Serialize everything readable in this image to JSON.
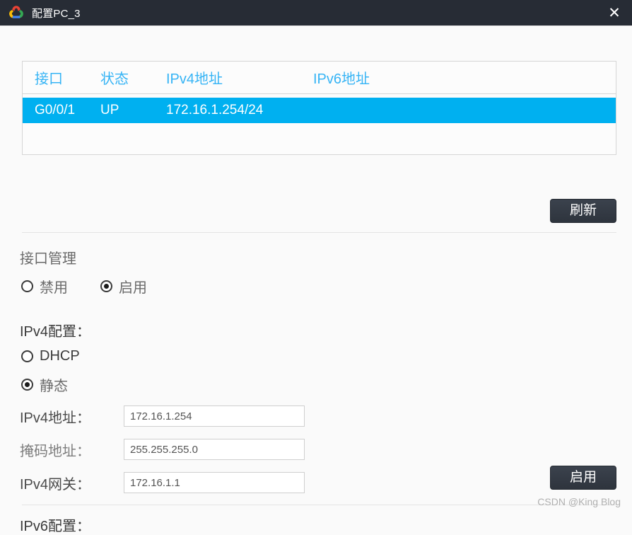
{
  "titlebar": {
    "icon": "cloud-logo-icon",
    "title": "配置PC_3",
    "close_label": "✕"
  },
  "interface_table": {
    "columns": [
      "接口",
      "状态",
      "IPv4地址",
      "IPv6地址"
    ],
    "rows": [
      {
        "interface": "G0/0/1",
        "state": "UP",
        "ipv4": "172.16.1.254/24",
        "ipv6": "",
        "selected": true
      }
    ],
    "header_color": "#36b4f5",
    "selected_row_color": "#00b0f0"
  },
  "buttons": {
    "refresh_label": "刷新",
    "apply_label": "启用"
  },
  "interface_management": {
    "label": "接口管理",
    "options": [
      {
        "label": "禁用",
        "selected": false
      },
      {
        "label": "启用",
        "selected": true
      }
    ]
  },
  "ipv4_config": {
    "label": "IPv4配置：",
    "mode_options": [
      {
        "label": "DHCP",
        "selected": false
      },
      {
        "label": "静态",
        "selected": true
      }
    ],
    "fields": [
      {
        "label": "IPv4地址：",
        "value": "172.16.1.254",
        "placeholder": ""
      },
      {
        "label": "掩码地址：",
        "value": "255.255.255.0",
        "placeholder": ""
      },
      {
        "label": "IPv4网关：",
        "value": "172.16.1.1",
        "placeholder": ""
      }
    ]
  },
  "ipv6_config": {
    "label": "IPv6配置："
  },
  "watermark": {
    "text": "CSDN @King Blog"
  }
}
